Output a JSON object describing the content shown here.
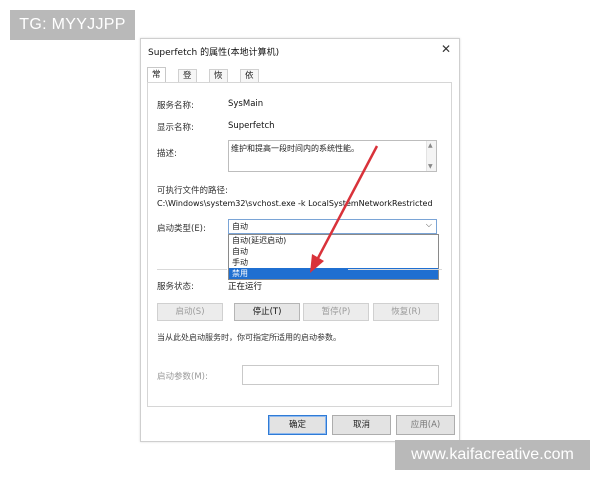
{
  "watermarks": {
    "top_left": "TG: MYYJJPP",
    "bottom_right": "www.kaifacreative.com"
  },
  "dialog": {
    "title": "Superfetch 的属性(本地计算机)",
    "close_icon": "close-icon",
    "tabs": [
      "常规",
      "登录",
      "恢复",
      "依存关系"
    ],
    "active_tab": "常规",
    "service_name_label": "服务名称:",
    "service_name_value": "SysMain",
    "display_name_label": "显示名称:",
    "display_name_value": "Superfetch",
    "description_label": "描述:",
    "description_value": "维护和提高一段时间内的系统性能。",
    "exe_path_label": "可执行文件的路径:",
    "exe_path_value": "C:\\Windows\\system32\\svchost.exe -k LocalSystemNetworkRestricted",
    "startup_type_label": "启动类型(E):",
    "startup_type_value": "自动",
    "startup_options": [
      "自动(延迟启动)",
      "自动",
      "手动",
      "禁用"
    ],
    "startup_highlighted": "禁用",
    "service_status_label": "服务状态:",
    "service_status_value": "正在运行",
    "buttons": {
      "start": "启动(S)",
      "stop": "停止(T)",
      "pause": "暂停(P)",
      "resume": "恢复(R)"
    },
    "hint": "当从此处启动服务时，你可指定所适用的启动参数。",
    "start_params_label": "启动参数(M):",
    "start_params_value": "",
    "footer": {
      "ok": "确定",
      "cancel": "取消",
      "apply": "应用(A)"
    }
  },
  "colors": {
    "selection": "#1f6fd1",
    "arrow": "#d9323a"
  }
}
